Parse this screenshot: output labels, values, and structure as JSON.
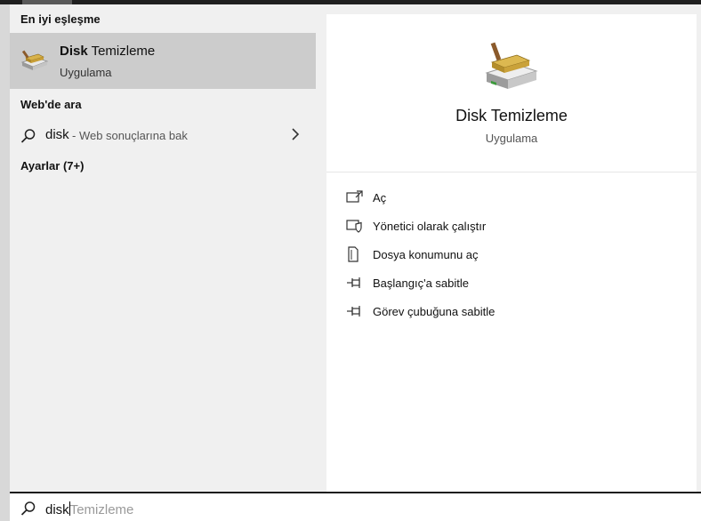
{
  "left": {
    "best_match_header": "En iyi eşleşme",
    "best_match": {
      "title_bold": "Disk",
      "title_rest": " Temizleme",
      "subtitle": "Uygulama",
      "icon": "disk-cleanup-icon"
    },
    "web_header": "Web'de ara",
    "web_search": {
      "query": "disk",
      "hint": " - Web sonuçlarına bak"
    },
    "settings_header": "Ayarlar (7+)"
  },
  "right": {
    "app_title": "Disk Temizleme",
    "app_subtitle": "Uygulama",
    "actions": [
      {
        "label": "Aç",
        "icon": "open-icon"
      },
      {
        "label": "Yönetici olarak çalıştır",
        "icon": "admin-shield-icon"
      },
      {
        "label": "Dosya konumunu aç",
        "icon": "file-location-icon"
      },
      {
        "label": "Başlangıç'a sabitle",
        "icon": "pin-icon"
      },
      {
        "label": "Görev çubuğuna sabitle",
        "icon": "pin-icon"
      }
    ]
  },
  "search": {
    "typed": "disk",
    "suggestion": "Temizleme"
  },
  "colors": {
    "selected_bg": "#cccccc",
    "pane_bg": "#f0f0f0",
    "detail_bg": "#ffffff"
  }
}
